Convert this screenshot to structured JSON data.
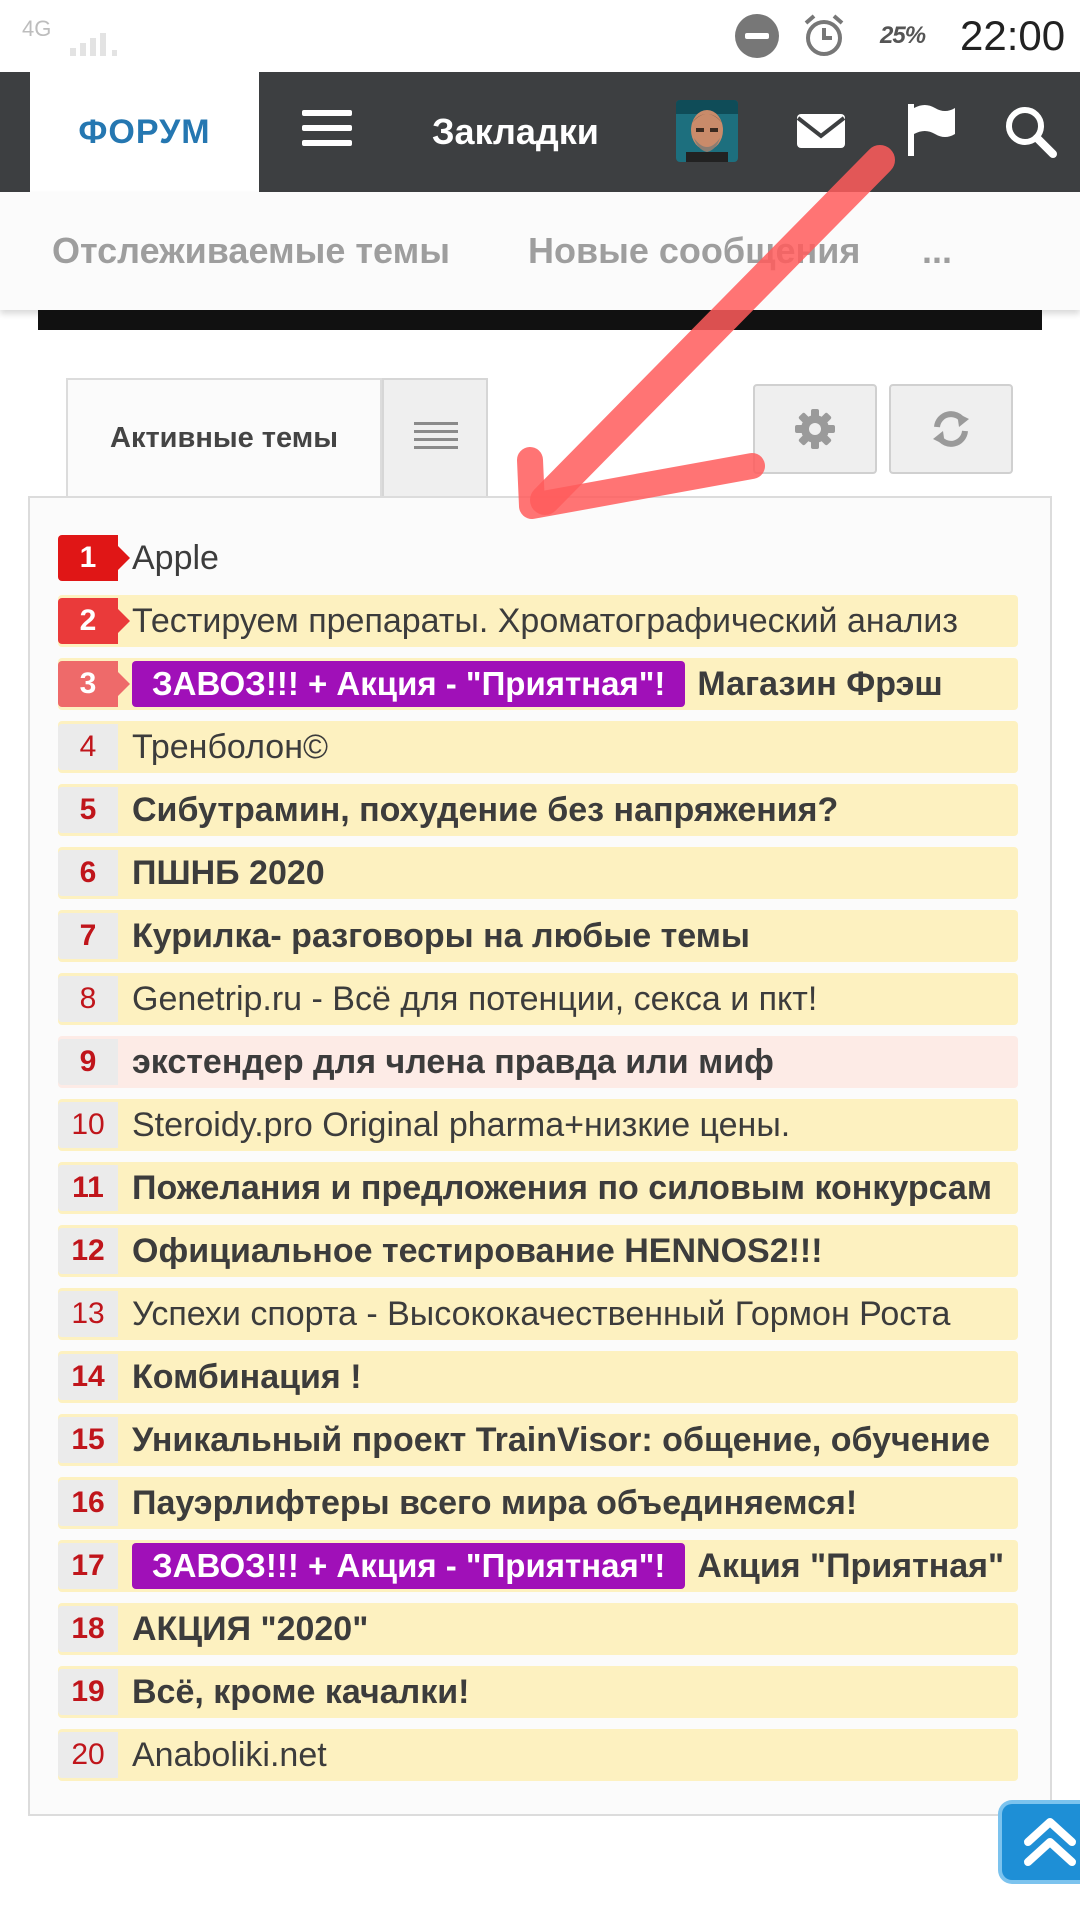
{
  "status_bar": {
    "network": "4G",
    "battery": "25%",
    "time": "22:00"
  },
  "navbar": {
    "forum_label": "ФОРУМ",
    "bookmarks_label": "Закладки"
  },
  "subnav": {
    "items": [
      {
        "label": "Отслеживаемые темы"
      },
      {
        "label": "Новые сообщения"
      },
      {
        "label": "..."
      }
    ]
  },
  "tabs": {
    "active_label": "Активные темы"
  },
  "colors": {
    "nav_bg": "#3d3f41",
    "forum_accent": "#2577b1",
    "row_bg": "#fdf1c0",
    "row_bg_hot": "#fdebe6",
    "prefix_tag": "#a010b8",
    "rank_text": "#c0151b",
    "annotation_arrow": "#ff5c5c"
  },
  "topics": [
    {
      "rank": "1",
      "title": "Apple",
      "prefix": "",
      "bold": false
    },
    {
      "rank": "2",
      "title": "Тестируем препараты. Хроматографический анализ",
      "prefix": "",
      "bold": false
    },
    {
      "rank": "3",
      "title": "Магазин Фрэш",
      "prefix": "ЗАВОЗ!!! + Акция - \"Приятная\"!",
      "bold": true
    },
    {
      "rank": "4",
      "title": "Тренболон©",
      "prefix": "",
      "bold": false
    },
    {
      "rank": "5",
      "title": "Сибутрамин, похудение без напряжения?",
      "prefix": "",
      "bold": true
    },
    {
      "rank": "6",
      "title": "ПШНБ 2020",
      "prefix": "",
      "bold": true
    },
    {
      "rank": "7",
      "title": "Курилка- разговоры на любые темы",
      "prefix": "",
      "bold": true
    },
    {
      "rank": "8",
      "title": "Genetrip.ru - Всё для потенции, секса и пкт!",
      "prefix": "",
      "bold": false
    },
    {
      "rank": "9",
      "title": "экстендер для члена правда или миф",
      "prefix": "",
      "bold": true
    },
    {
      "rank": "10",
      "title": "Steroidy.pro Original pharma+низкие цены.",
      "prefix": "",
      "bold": false
    },
    {
      "rank": "11",
      "title": "Пожелания и предложения по силовым конкурсам",
      "prefix": "",
      "bold": true
    },
    {
      "rank": "12",
      "title": "Официальное тестирование HENNOS2!!!",
      "prefix": "",
      "bold": true
    },
    {
      "rank": "13",
      "title": "Успехи спорта - Высококачественный Гормон Роста",
      "prefix": "",
      "bold": false
    },
    {
      "rank": "14",
      "title": "Комбинация !",
      "prefix": "",
      "bold": true
    },
    {
      "rank": "15",
      "title": "Уникальный проект TrainVisor: общение, обучение",
      "prefix": "",
      "bold": true
    },
    {
      "rank": "16",
      "title": "Пауэрлифтеры всего мира объединяемся!",
      "prefix": "",
      "bold": true
    },
    {
      "rank": "17",
      "title": "Акция \"Приятная\"",
      "prefix": "ЗАВОЗ!!! + Акция - \"Приятная\"!",
      "bold": true
    },
    {
      "rank": "18",
      "title": "АКЦИЯ \"2020\"",
      "prefix": "",
      "bold": true
    },
    {
      "rank": "19",
      "title": "Всё, кроме качалки!",
      "prefix": "",
      "bold": true
    },
    {
      "rank": "20",
      "title": "Anaboliki.net",
      "prefix": "",
      "bold": false
    }
  ]
}
